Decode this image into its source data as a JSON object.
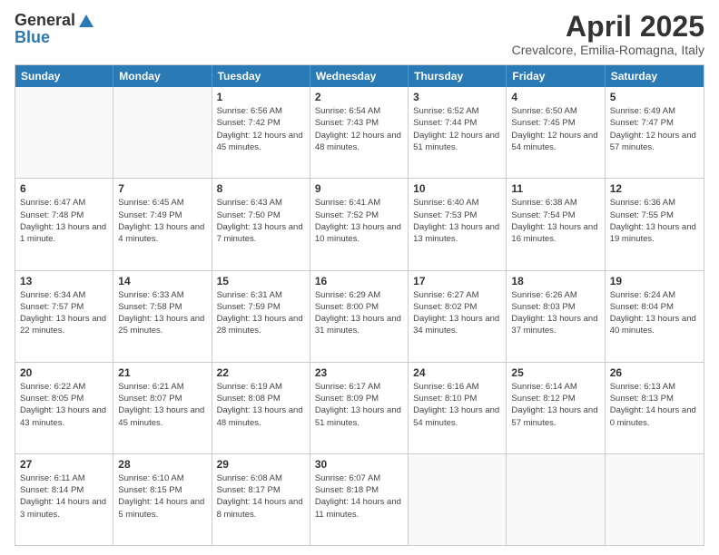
{
  "logo": {
    "general": "General",
    "blue": "Blue"
  },
  "title": "April 2025",
  "location": "Crevalcore, Emilia-Romagna, Italy",
  "header_days": [
    "Sunday",
    "Monday",
    "Tuesday",
    "Wednesday",
    "Thursday",
    "Friday",
    "Saturday"
  ],
  "weeks": [
    [
      {
        "day": "",
        "info": ""
      },
      {
        "day": "",
        "info": ""
      },
      {
        "day": "1",
        "info": "Sunrise: 6:56 AM\nSunset: 7:42 PM\nDaylight: 12 hours and 45 minutes."
      },
      {
        "day": "2",
        "info": "Sunrise: 6:54 AM\nSunset: 7:43 PM\nDaylight: 12 hours and 48 minutes."
      },
      {
        "day": "3",
        "info": "Sunrise: 6:52 AM\nSunset: 7:44 PM\nDaylight: 12 hours and 51 minutes."
      },
      {
        "day": "4",
        "info": "Sunrise: 6:50 AM\nSunset: 7:45 PM\nDaylight: 12 hours and 54 minutes."
      },
      {
        "day": "5",
        "info": "Sunrise: 6:49 AM\nSunset: 7:47 PM\nDaylight: 12 hours and 57 minutes."
      }
    ],
    [
      {
        "day": "6",
        "info": "Sunrise: 6:47 AM\nSunset: 7:48 PM\nDaylight: 13 hours and 1 minute."
      },
      {
        "day": "7",
        "info": "Sunrise: 6:45 AM\nSunset: 7:49 PM\nDaylight: 13 hours and 4 minutes."
      },
      {
        "day": "8",
        "info": "Sunrise: 6:43 AM\nSunset: 7:50 PM\nDaylight: 13 hours and 7 minutes."
      },
      {
        "day": "9",
        "info": "Sunrise: 6:41 AM\nSunset: 7:52 PM\nDaylight: 13 hours and 10 minutes."
      },
      {
        "day": "10",
        "info": "Sunrise: 6:40 AM\nSunset: 7:53 PM\nDaylight: 13 hours and 13 minutes."
      },
      {
        "day": "11",
        "info": "Sunrise: 6:38 AM\nSunset: 7:54 PM\nDaylight: 13 hours and 16 minutes."
      },
      {
        "day": "12",
        "info": "Sunrise: 6:36 AM\nSunset: 7:55 PM\nDaylight: 13 hours and 19 minutes."
      }
    ],
    [
      {
        "day": "13",
        "info": "Sunrise: 6:34 AM\nSunset: 7:57 PM\nDaylight: 13 hours and 22 minutes."
      },
      {
        "day": "14",
        "info": "Sunrise: 6:33 AM\nSunset: 7:58 PM\nDaylight: 13 hours and 25 minutes."
      },
      {
        "day": "15",
        "info": "Sunrise: 6:31 AM\nSunset: 7:59 PM\nDaylight: 13 hours and 28 minutes."
      },
      {
        "day": "16",
        "info": "Sunrise: 6:29 AM\nSunset: 8:00 PM\nDaylight: 13 hours and 31 minutes."
      },
      {
        "day": "17",
        "info": "Sunrise: 6:27 AM\nSunset: 8:02 PM\nDaylight: 13 hours and 34 minutes."
      },
      {
        "day": "18",
        "info": "Sunrise: 6:26 AM\nSunset: 8:03 PM\nDaylight: 13 hours and 37 minutes."
      },
      {
        "day": "19",
        "info": "Sunrise: 6:24 AM\nSunset: 8:04 PM\nDaylight: 13 hours and 40 minutes."
      }
    ],
    [
      {
        "day": "20",
        "info": "Sunrise: 6:22 AM\nSunset: 8:05 PM\nDaylight: 13 hours and 43 minutes."
      },
      {
        "day": "21",
        "info": "Sunrise: 6:21 AM\nSunset: 8:07 PM\nDaylight: 13 hours and 45 minutes."
      },
      {
        "day": "22",
        "info": "Sunrise: 6:19 AM\nSunset: 8:08 PM\nDaylight: 13 hours and 48 minutes."
      },
      {
        "day": "23",
        "info": "Sunrise: 6:17 AM\nSunset: 8:09 PM\nDaylight: 13 hours and 51 minutes."
      },
      {
        "day": "24",
        "info": "Sunrise: 6:16 AM\nSunset: 8:10 PM\nDaylight: 13 hours and 54 minutes."
      },
      {
        "day": "25",
        "info": "Sunrise: 6:14 AM\nSunset: 8:12 PM\nDaylight: 13 hours and 57 minutes."
      },
      {
        "day": "26",
        "info": "Sunrise: 6:13 AM\nSunset: 8:13 PM\nDaylight: 14 hours and 0 minutes."
      }
    ],
    [
      {
        "day": "27",
        "info": "Sunrise: 6:11 AM\nSunset: 8:14 PM\nDaylight: 14 hours and 3 minutes."
      },
      {
        "day": "28",
        "info": "Sunrise: 6:10 AM\nSunset: 8:15 PM\nDaylight: 14 hours and 5 minutes."
      },
      {
        "day": "29",
        "info": "Sunrise: 6:08 AM\nSunset: 8:17 PM\nDaylight: 14 hours and 8 minutes."
      },
      {
        "day": "30",
        "info": "Sunrise: 6:07 AM\nSunset: 8:18 PM\nDaylight: 14 hours and 11 minutes."
      },
      {
        "day": "",
        "info": ""
      },
      {
        "day": "",
        "info": ""
      },
      {
        "day": "",
        "info": ""
      }
    ]
  ]
}
